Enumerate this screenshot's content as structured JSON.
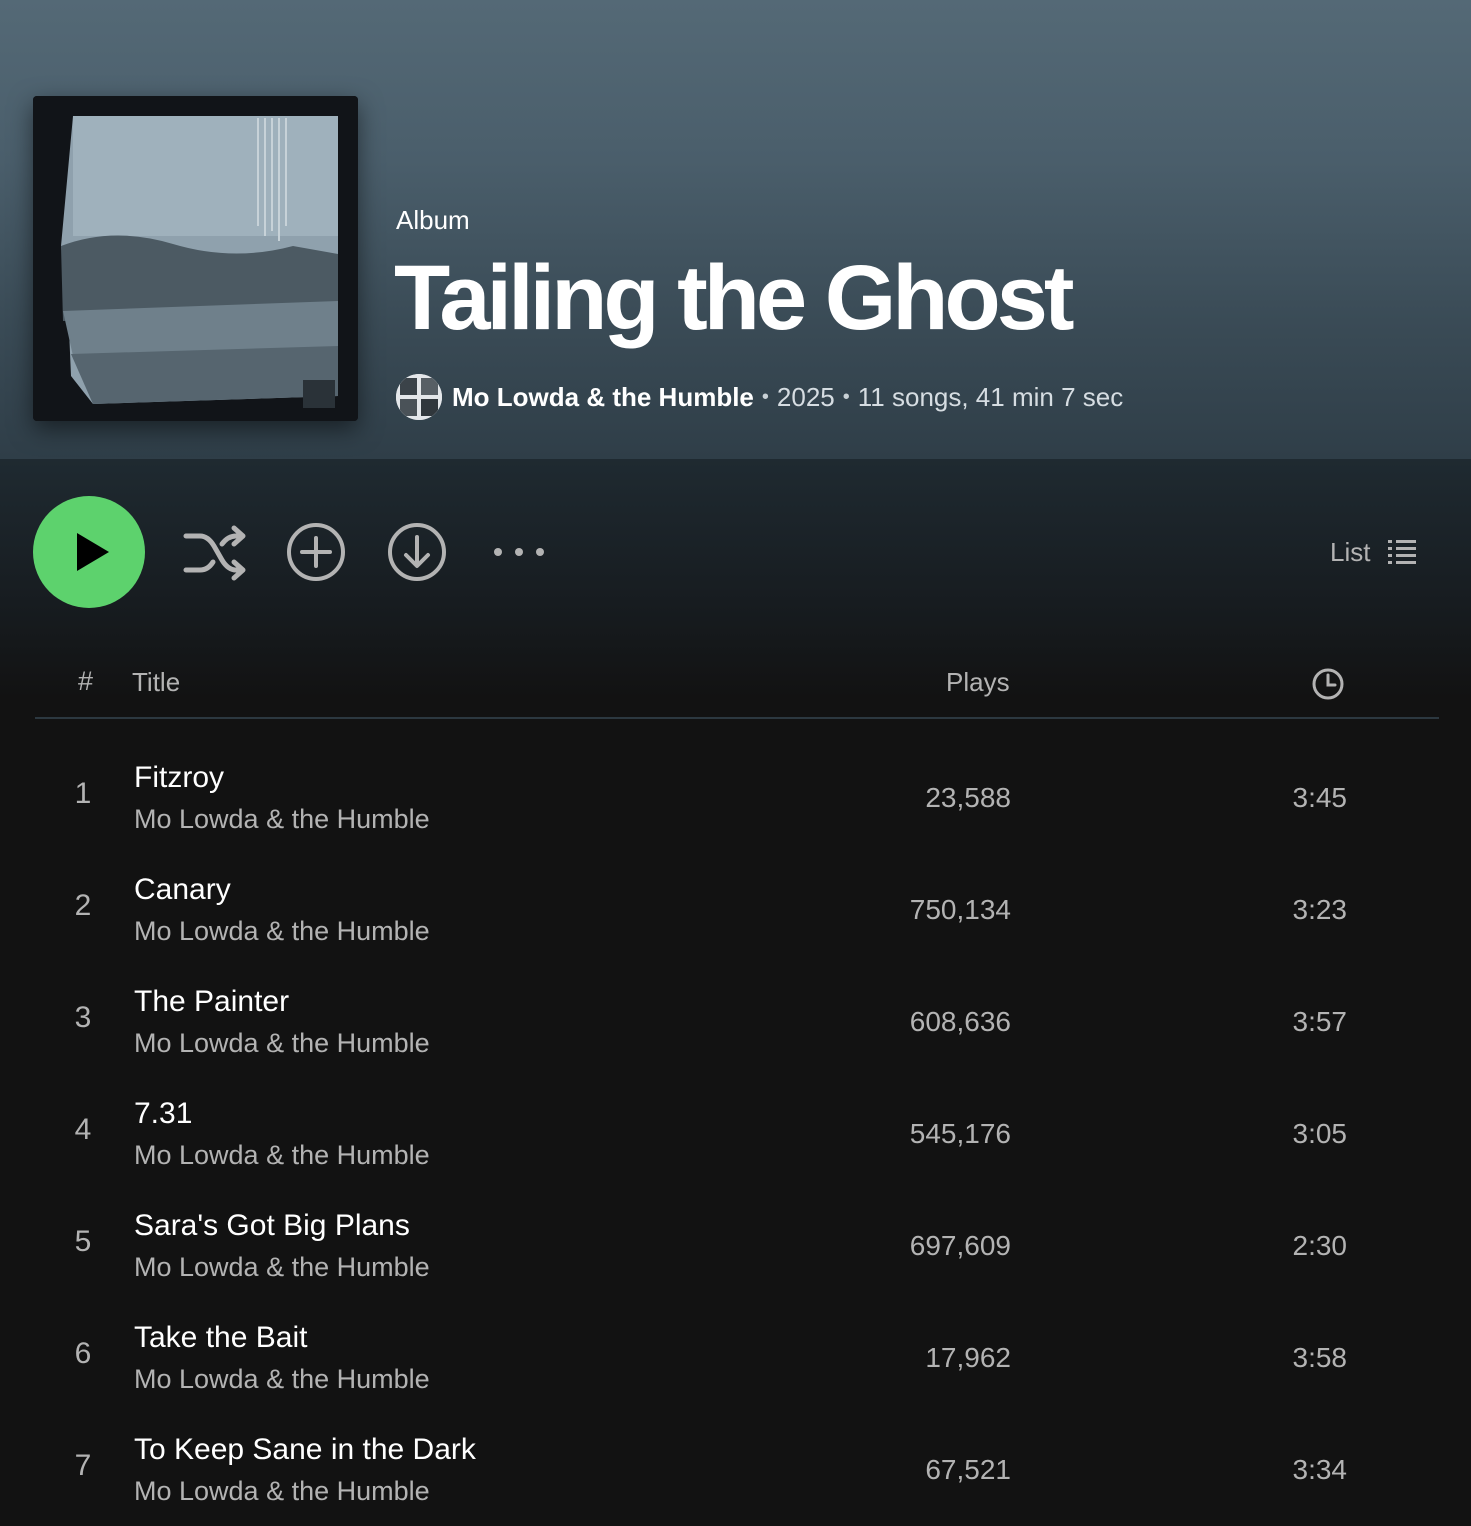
{
  "album": {
    "type_label": "Album",
    "title": "Tailing the Ghost",
    "artist": "Mo Lowda & the Humble",
    "year": "2025",
    "summary": "11 songs, 41 min 7 sec",
    "separator": "•"
  },
  "actions": {
    "view_label": "List"
  },
  "columns": {
    "number": "#",
    "title": "Title",
    "plays": "Plays"
  },
  "icons": {
    "play": "play-icon",
    "shuffle": "shuffle-icon",
    "add": "add-circle-icon",
    "download": "download-circle-icon",
    "more": "more-dots-icon",
    "list": "list-view-icon",
    "clock": "clock-icon"
  },
  "colors": {
    "accent": "#5dd26d",
    "header_top": "#546976",
    "background": "#121212",
    "secondary_text": "#b3b3b3"
  },
  "tracks": [
    {
      "number": "1",
      "title": "Fitzroy",
      "artist": "Mo Lowda & the Humble",
      "plays": "23,588",
      "duration": "3:45"
    },
    {
      "number": "2",
      "title": "Canary",
      "artist": "Mo Lowda & the Humble",
      "plays": "750,134",
      "duration": "3:23"
    },
    {
      "number": "3",
      "title": "The Painter",
      "artist": "Mo Lowda & the Humble",
      "plays": "608,636",
      "duration": "3:57"
    },
    {
      "number": "4",
      "title": "7.31",
      "artist": "Mo Lowda & the Humble",
      "plays": "545,176",
      "duration": "3:05"
    },
    {
      "number": "5",
      "title": "Sara's Got Big Plans",
      "artist": "Mo Lowda & the Humble",
      "plays": "697,609",
      "duration": "2:30"
    },
    {
      "number": "6",
      "title": "Take the Bait",
      "artist": "Mo Lowda & the Humble",
      "plays": "17,962",
      "duration": "3:58"
    },
    {
      "number": "7",
      "title": "To Keep Sane in the Dark",
      "artist": "Mo Lowda & the Humble",
      "plays": "67,521",
      "duration": "3:34"
    }
  ]
}
